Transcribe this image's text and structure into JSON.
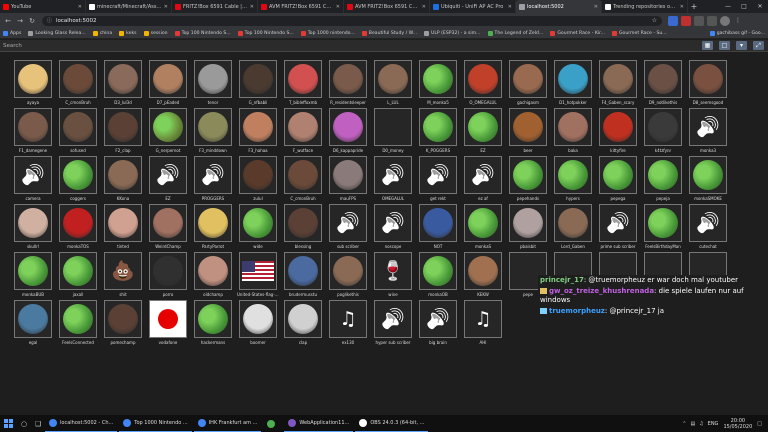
{
  "browser": {
    "tabs": [
      {
        "label": "YouTube",
        "color": "#ff0000",
        "active": false
      },
      {
        "label": "minecraft/Minecraft/Assets",
        "color": "#ffffff",
        "active": false
      },
      {
        "label": "FRITZ!Box 6591 Cable | AVM",
        "color": "#e30613",
        "active": false
      },
      {
        "label": "AVM FRITZ!Box 6591 Cable | AVM",
        "color": "#e30613",
        "active": false
      },
      {
        "label": "AVM FRITZ!Box 6591 Cable | AVM",
        "color": "#e30613",
        "active": false
      },
      {
        "label": "Ubiquiti - UniFi AP AC Pro",
        "color": "#1d6ee0",
        "active": false
      },
      {
        "label": "localhost:5002",
        "color": "#9aa0a6",
        "active": true
      },
      {
        "label": "Trending repositories on GitHub",
        "color": "#ffffff",
        "active": false
      }
    ],
    "address": "localhost:5002",
    "bookmarks": [
      {
        "label": "Apps",
        "color": "#4285f4"
      },
      {
        "label": "Looking Glass Relea...",
        "color": "#9e9e9e"
      },
      {
        "label": "china",
        "color": "#f4b400"
      },
      {
        "label": "keks",
        "color": "#f4b400"
      },
      {
        "label": "session",
        "color": "#f4b400"
      },
      {
        "label": "Top 100 Nintendo S...",
        "color": "#e53935"
      },
      {
        "label": "Top 100 Nintendo S...",
        "color": "#e53935"
      },
      {
        "label": "Top 1000 nintendo...",
        "color": "#e53935"
      },
      {
        "label": "Beautiful Study / W...",
        "color": "#e53935"
      },
      {
        "label": "ULP (ESP32) - a sim...",
        "color": "#9e9e9e"
      },
      {
        "label": "The Legend of Zeld...",
        "color": "#4caf50"
      },
      {
        "label": "Gourmet Race - Kir...",
        "color": "#e53935"
      },
      {
        "label": "Gourmet Race - Su...",
        "color": "#e53935"
      }
    ],
    "bookmarks_right": "gachibass gif - Goo..."
  },
  "search": {
    "placeholder": "Search"
  },
  "emotes": [
    {
      "name": "ayaya",
      "kind": "photo",
      "color": "#e6c27a"
    },
    {
      "name": "C_cmonBruh",
      "kind": "photo",
      "color": "#6b4a3a"
    },
    {
      "name": "D3_lul3d",
      "kind": "photo",
      "color": "#8a6a5a"
    },
    {
      "name": "D7_pEaded",
      "kind": "photo",
      "color": "#b08060"
    },
    {
      "name": "tenor",
      "kind": "photo",
      "color": "#9a9a9a"
    },
    {
      "name": "G_nfbabli",
      "kind": "photo",
      "color": "#4a3a30"
    },
    {
      "name": "T_bibleffoxmb",
      "kind": "photo",
      "color": "#d25050"
    },
    {
      "name": "R_residentsleeper",
      "kind": "photo",
      "color": "#7a5a4a"
    },
    {
      "name": "L_LUL",
      "kind": "photo",
      "color": "#8a6a55"
    },
    {
      "name": "M_monka5",
      "kind": "pepe",
      "color": "#4a9a3a"
    },
    {
      "name": "O_OMEGALUL",
      "kind": "photo",
      "color": "#c0402a"
    },
    {
      "name": "gachigasm",
      "kind": "photo",
      "color": "#9a6a50"
    },
    {
      "name": "D1_hotpokker",
      "kind": "photo",
      "color": "#3aa0c8"
    },
    {
      "name": "F4_Gaben_scary",
      "kind": "photo",
      "color": "#8a6a55"
    },
    {
      "name": "D9_notlikethis",
      "kind": "photo",
      "color": "#6a5045"
    },
    {
      "name": "D8_seemsgood",
      "kind": "photo",
      "color": "#7a5040"
    },
    {
      "name": "F1_damegene",
      "kind": "photo",
      "color": "#7a5a4a"
    },
    {
      "name": "sofused",
      "kind": "photo",
      "color": "#6a5040"
    },
    {
      "name": "F2_clap",
      "kind": "photo",
      "color": "#5a4035"
    },
    {
      "name": "G_nerpernot",
      "kind": "pepe",
      "color": "#6a8a3a"
    },
    {
      "name": "F3_minddown",
      "kind": "photo",
      "color": "#8a8a5a"
    },
    {
      "name": "F3_hahaa",
      "kind": "photo",
      "color": "#c08060"
    },
    {
      "name": "F_wutface",
      "kind": "photo",
      "color": "#b08070"
    },
    {
      "name": "D6_kappapride",
      "kind": "photo",
      "color": "#c060c0"
    },
    {
      "name": "D0_money",
      "kind": "blank",
      "color": "#262626"
    },
    {
      "name": "K_POGGERS",
      "kind": "pepe",
      "color": "#4a9a3a"
    },
    {
      "name": "EZ",
      "kind": "pepe",
      "color": "#4a9a3a"
    },
    {
      "name": "beer",
      "kind": "photo",
      "color": "#a06030"
    },
    {
      "name": "baka",
      "kind": "photo",
      "color": "#a07060"
    },
    {
      "name": "kittyfire",
      "kind": "photo",
      "color": "#c03020"
    },
    {
      "name": "k4tzfynr",
      "kind": "photo",
      "color": "#3a3a3a"
    },
    {
      "name": "monka3",
      "kind": "audio",
      "color": "#262626"
    },
    {
      "name": "camera",
      "kind": "audio",
      "color": "#262626"
    },
    {
      "name": "coggers",
      "kind": "pepe",
      "color": "#4a9a3a"
    },
    {
      "name": "KKona",
      "kind": "photo",
      "color": "#8a6a55"
    },
    {
      "name": "EZ",
      "kind": "audio",
      "color": "#262626"
    },
    {
      "name": "PROGGERS",
      "kind": "audio",
      "color": "#262626"
    },
    {
      "name": "zulul",
      "kind": "photo",
      "color": "#5a3a2a"
    },
    {
      "name": "C_cmonBruh",
      "kind": "photo",
      "color": "#6b4a3a"
    },
    {
      "name": "mauFPS",
      "kind": "photo",
      "color": "#8a7a7a"
    },
    {
      "name": "OMEGALUL",
      "kind": "audio",
      "color": "#262626"
    },
    {
      "name": "get rekt",
      "kind": "audio",
      "color": "#262626"
    },
    {
      "name": "ez af",
      "kind": "audio",
      "color": "#262626"
    },
    {
      "name": "pepehands",
      "kind": "pepe",
      "color": "#4a9a3a"
    },
    {
      "name": "hypers",
      "kind": "pepe",
      "color": "#4a9a3a"
    },
    {
      "name": "pepega",
      "kind": "pepe",
      "color": "#4a9a3a"
    },
    {
      "name": "pepeja",
      "kind": "pepe",
      "color": "#4a9a3a"
    },
    {
      "name": "monkaSMOKE",
      "kind": "pepe",
      "color": "#4a9a3a"
    },
    {
      "name": "skullrl",
      "kind": "photo",
      "color": "#d0b0a0"
    },
    {
      "name": "monkaTOS",
      "kind": "photo",
      "color": "#c02020"
    },
    {
      "name": "tinted",
      "kind": "photo",
      "color": "#d0a090"
    },
    {
      "name": "WeirdChamp",
      "kind": "photo",
      "color": "#a07060"
    },
    {
      "name": "PartyParrot",
      "kind": "photo",
      "color": "#e0c060"
    },
    {
      "name": "wide",
      "kind": "pepe",
      "color": "#4a9a3a"
    },
    {
      "name": "blessing",
      "kind": "photo",
      "color": "#5a4035"
    },
    {
      "name": "sub scriber",
      "kind": "audio",
      "color": "#262626"
    },
    {
      "name": "noscope",
      "kind": "audio",
      "color": "#262626"
    },
    {
      "name": "NOT",
      "kind": "photo",
      "color": "#3a5aa0"
    },
    {
      "name": "monkaS",
      "kind": "pepe",
      "color": "#4a9a3a"
    },
    {
      "name": "pbaisbit",
      "kind": "photo",
      "color": "#b0a0a0"
    },
    {
      "name": "Lord_Gaben",
      "kind": "photo",
      "color": "#8a6a55"
    },
    {
      "name": "prime sub scriber",
      "kind": "audio",
      "color": "#262626"
    },
    {
      "name": "FeelsBirthdayMan",
      "kind": "pepe",
      "color": "#4a9a3a"
    },
    {
      "name": "cutechat",
      "kind": "audio",
      "color": "#262626"
    },
    {
      "name": "monkaBUB",
      "kind": "pepe",
      "color": "#4a9a3a"
    },
    {
      "name": "jaxall",
      "kind": "pepe",
      "color": "#4a9a3a"
    },
    {
      "name": "shit",
      "kind": "poop",
      "color": "#8a5a2a"
    },
    {
      "name": "porro",
      "kind": "photo",
      "color": "#303030"
    },
    {
      "name": "oldchamp",
      "kind": "photo",
      "color": "#c09080"
    },
    {
      "name": "United-States-flag-pdf-1300x1881 Keffy",
      "kind": "flag",
      "color": "#b22234"
    },
    {
      "name": "brudermusstu",
      "kind": "photo",
      "color": "#4a6aa0"
    },
    {
      "name": "poglikethis",
      "kind": "photo",
      "color": "#8a6a55"
    },
    {
      "name": "wine",
      "kind": "wine",
      "color": "#a01020"
    },
    {
      "name": "monkaOB",
      "kind": "pepe",
      "color": "#4a9a3a"
    },
    {
      "name": "KEKW",
      "kind": "photo",
      "color": "#a07050"
    },
    {
      "name": "pepe",
      "kind": "blank",
      "color": "#262626"
    },
    {
      "name": "pepe",
      "kind": "blank",
      "color": "#262626"
    },
    {
      "name": "pepe",
      "kind": "blank",
      "color": "#262626"
    },
    {
      "name": "pepe",
      "kind": "blank",
      "color": "#262626"
    },
    {
      "name": "pepe",
      "kind": "blank",
      "color": "#262626"
    },
    {
      "name": "egal",
      "kind": "photo",
      "color": "#4a7aa0"
    },
    {
      "name": "FeelsConnected",
      "kind": "pepe",
      "color": "#4a9a3a"
    },
    {
      "name": "pomechamp",
      "kind": "photo",
      "color": "#5a4035"
    },
    {
      "name": "vodafone",
      "kind": "vodafone",
      "color": "#e60000"
    },
    {
      "name": "hackermans",
      "kind": "pepe",
      "color": "#4a9a3a"
    },
    {
      "name": "boomer",
      "kind": "photo",
      "color": "#e0e0e0"
    },
    {
      "name": "clap",
      "kind": "photo",
      "color": "#d0d0d0"
    },
    {
      "name": "ex130",
      "kind": "music",
      "color": "#262626"
    },
    {
      "name": "hyper sub scriber",
      "kind": "audio",
      "color": "#262626"
    },
    {
      "name": "big brain",
      "kind": "audio",
      "color": "#262626"
    },
    {
      "name": "AHI",
      "kind": "music",
      "color": "#262626"
    }
  ],
  "chat": [
    {
      "user": "princejr_17",
      "user_color": "#7fd17f",
      "text": ": @truemorpheuz er war doch mal youtuber",
      "badge": false
    },
    {
      "user": "gw_oz_treize_khushrenada",
      "user_color": "#c060e0",
      "text": ": die spiele laufen nur auf windows",
      "badge": true,
      "badge_color": "#e0c060"
    },
    {
      "user": "truemorpheuz",
      "user_color": "#3aa0ff",
      "text": ": @princejr_17 ja",
      "badge": true,
      "badge_color": "#7fd1ff"
    }
  ],
  "taskbar": {
    "apps": [
      {
        "label": "localhost:5002 - Ch...",
        "color": "#4285f4",
        "active": true
      },
      {
        "label": "Top 1000 Nintendo ...",
        "color": "#4285f4",
        "active": true
      },
      {
        "label": "IHK Frankfurt am ...",
        "color": "#4285f4",
        "active": true
      },
      {
        "label": "",
        "color": "#4caf50",
        "active": false
      },
      {
        "label": "WebApplication11...",
        "color": "#7e57c2",
        "active": true
      },
      {
        "label": "OBS 24.0.3 (64-bit, ...",
        "color": "#ffffff",
        "active": true
      }
    ],
    "tray_lang": "ENG",
    "time": "20:00",
    "date": "15/05/2020"
  }
}
